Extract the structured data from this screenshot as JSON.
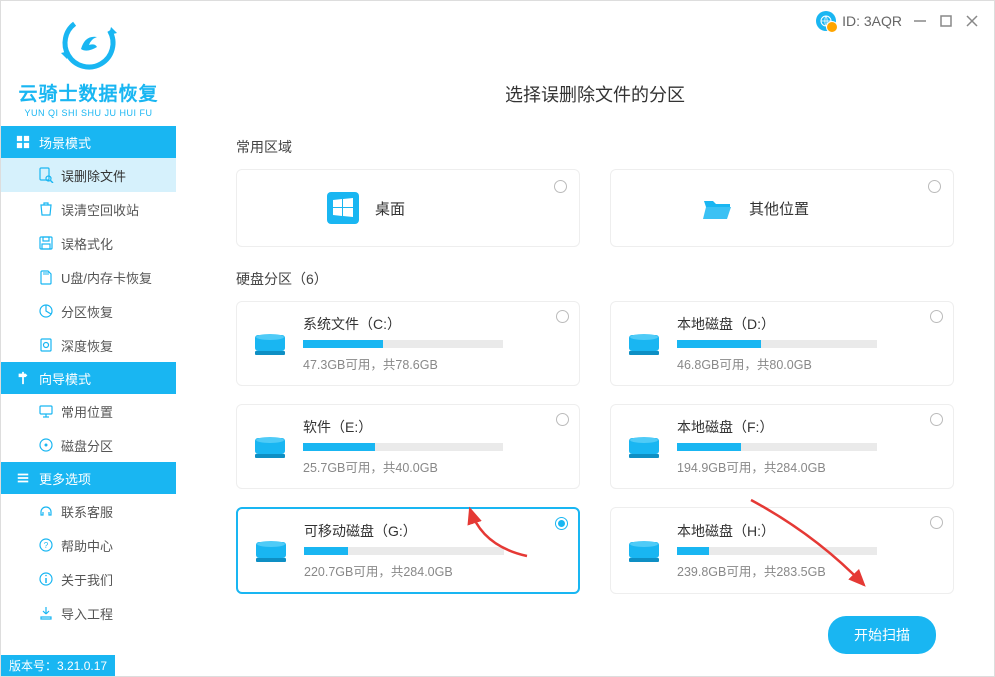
{
  "titlebar": {
    "id_label": "ID: 3AQR"
  },
  "brand": {
    "name": "云骑士数据恢复",
    "pinyin": "YUN QI SHI SHU JU HUI FU"
  },
  "sections": {
    "scene": {
      "label": "场景模式"
    },
    "wizard": {
      "label": "向导模式"
    },
    "more": {
      "label": "更多选项"
    }
  },
  "nav": {
    "scene": [
      {
        "label": "误删除文件",
        "active": true
      },
      {
        "label": "误清空回收站"
      },
      {
        "label": "误格式化"
      },
      {
        "label": "U盘/内存卡恢复"
      },
      {
        "label": "分区恢复"
      },
      {
        "label": "深度恢复"
      }
    ],
    "wizard": [
      {
        "label": "常用位置"
      },
      {
        "label": "磁盘分区"
      }
    ],
    "more": [
      {
        "label": "联系客服"
      },
      {
        "label": "帮助中心"
      },
      {
        "label": "关于我们"
      },
      {
        "label": "导入工程"
      }
    ]
  },
  "main": {
    "title": "选择误删除文件的分区",
    "common_label": "常用区域",
    "common_items": [
      {
        "label": "桌面"
      },
      {
        "label": "其他位置"
      }
    ],
    "disk_label_prefix": "硬盘分区（",
    "disk_label_suffix": "）",
    "disk_count": 6,
    "disks": [
      {
        "name": "系统文件（C:）",
        "usage": "47.3GB可用，共78.6GB",
        "used_pct": 40
      },
      {
        "name": "本地磁盘（D:）",
        "usage": "46.8GB可用，共80.0GB",
        "used_pct": 42
      },
      {
        "name": "软件（E:）",
        "usage": "25.7GB可用，共40.0GB",
        "used_pct": 36
      },
      {
        "name": "本地磁盘（F:）",
        "usage": "194.9GB可用，共284.0GB",
        "used_pct": 32
      },
      {
        "name": "可移动磁盘（G:）",
        "usage": "220.7GB可用，共284.0GB",
        "used_pct": 22,
        "selected": true
      },
      {
        "name": "本地磁盘（H:）",
        "usage": "239.8GB可用，共283.5GB",
        "used_pct": 16
      }
    ],
    "scan_button": "开始扫描"
  },
  "version": {
    "label": "版本号：3.21.0.17"
  }
}
